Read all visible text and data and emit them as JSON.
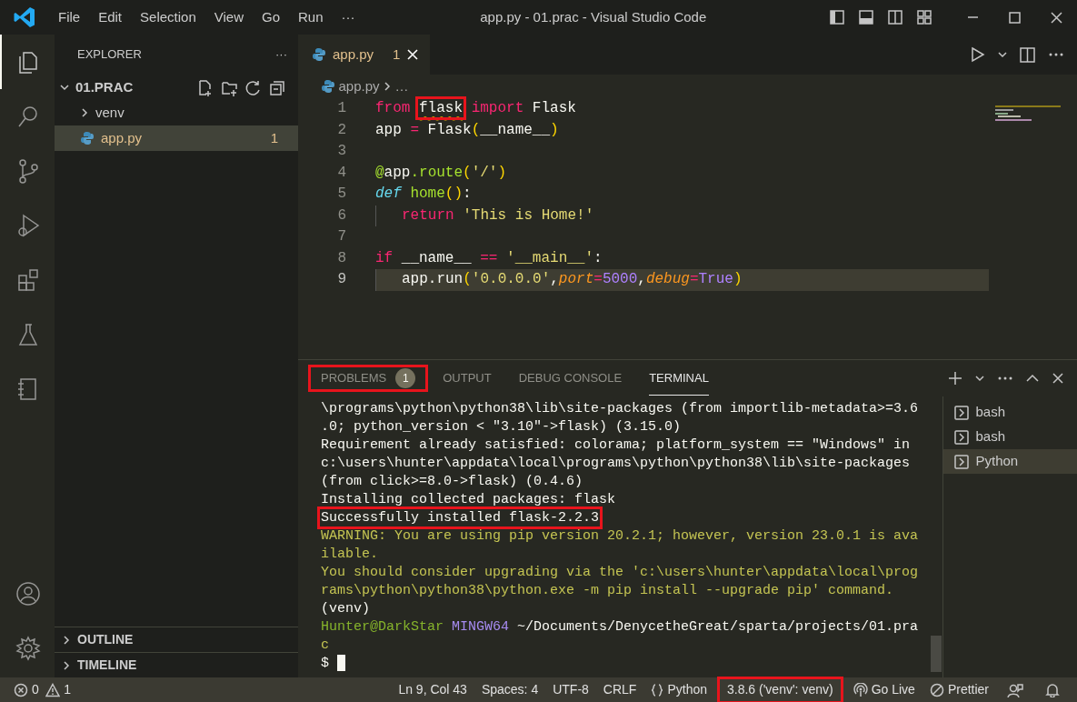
{
  "window": {
    "title": "app.py - 01.prac - Visual Studio Code"
  },
  "menu": [
    "File",
    "Edit",
    "Selection",
    "View",
    "Go",
    "Run",
    "···"
  ],
  "activity_bar": [
    {
      "kind": "explorer",
      "selected": true
    },
    {
      "kind": "search",
      "selected": false
    },
    {
      "kind": "source-control",
      "selected": false
    },
    {
      "kind": "run-debug",
      "selected": false
    },
    {
      "kind": "extensions",
      "selected": false
    },
    {
      "kind": "testing",
      "selected": false
    },
    {
      "kind": "notebook",
      "selected": false
    },
    {
      "kind": "account",
      "selected": false
    },
    {
      "kind": "settings",
      "selected": false
    }
  ],
  "sidebar": {
    "title": "EXPLORER",
    "more": "···",
    "folder": {
      "name": "01.PRAC",
      "expanded": true,
      "children": [
        {
          "name": "venv",
          "kind": "folder",
          "expanded": false,
          "selected": false
        },
        {
          "name": "app.py",
          "kind": "python",
          "problems": "1",
          "selected": true
        }
      ]
    },
    "sections": [
      {
        "name": "OUTLINE",
        "expanded": false
      },
      {
        "name": "TIMELINE",
        "expanded": false
      }
    ]
  },
  "editor": {
    "tabs": [
      {
        "label": "app.py",
        "problems": "1",
        "selected": true
      }
    ],
    "breadcrumb": [
      "app.py",
      "…"
    ],
    "lines": [
      {
        "number": "1",
        "current": false,
        "tokens": [
          {
            "text": "from ",
            "kind": "keyword"
          },
          {
            "text": "flask",
            "kind": "plain",
            "squiggle": true,
            "highlighted": true
          },
          {
            "text": " import",
            "kind": "keyword"
          },
          {
            "text": " Flask",
            "kind": "plain"
          }
        ]
      },
      {
        "number": "2",
        "current": false,
        "tokens": [
          {
            "text": "app ",
            "kind": "plain"
          },
          {
            "text": "=",
            "kind": "keyword"
          },
          {
            "text": " Flask",
            "kind": "plain"
          },
          {
            "text": "(",
            "kind": "bracket"
          },
          {
            "text": "__name__",
            "kind": "plain"
          },
          {
            "text": ")",
            "kind": "bracket"
          }
        ]
      },
      {
        "number": "3",
        "current": false
      },
      {
        "number": "4",
        "current": false,
        "tokens": [
          {
            "text": "@",
            "kind": "func"
          },
          {
            "text": "app",
            "kind": "plain"
          },
          {
            "text": ".route",
            "kind": "func"
          },
          {
            "text": "(",
            "kind": "bracket"
          },
          {
            "text": "'/'",
            "kind": "string"
          },
          {
            "text": ")",
            "kind": "bracket"
          }
        ]
      },
      {
        "number": "5",
        "current": false,
        "tokens": [
          {
            "text": "def",
            "kind": "storage"
          },
          {
            "text": " home",
            "kind": "func"
          },
          {
            "text": "()",
            "kind": "bracket"
          },
          {
            "text": ":",
            "kind": "plain"
          }
        ]
      },
      {
        "number": "6",
        "current": false,
        "indented": true,
        "tokens": [
          {
            "text": "return",
            "kind": "keyword"
          },
          {
            "text": " 'This is Home!'",
            "kind": "string"
          }
        ]
      },
      {
        "number": "7",
        "current": false
      },
      {
        "number": "8",
        "current": false,
        "tokens": [
          {
            "text": "if",
            "kind": "keyword"
          },
          {
            "text": " __name__ ",
            "kind": "plain"
          },
          {
            "text": "==",
            "kind": "keyword"
          },
          {
            "text": " '__main__'",
            "kind": "string"
          },
          {
            "text": ":",
            "kind": "plain"
          }
        ]
      },
      {
        "number": "9",
        "current": true,
        "indented": true,
        "tokens": [
          {
            "text": "app.run",
            "kind": "plain"
          },
          {
            "text": "(",
            "kind": "bracket"
          },
          {
            "text": "'0.0.0.0'",
            "kind": "string"
          },
          {
            "text": ",",
            "kind": "plain"
          },
          {
            "text": "port",
            "kind": "param"
          },
          {
            "text": "=",
            "kind": "keyword"
          },
          {
            "text": "5000",
            "kind": "number"
          },
          {
            "text": ",",
            "kind": "plain"
          },
          {
            "text": "debug",
            "kind": "param"
          },
          {
            "text": "=",
            "kind": "keyword"
          },
          {
            "text": "True",
            "kind": "number"
          },
          {
            "text": ")",
            "kind": "bracket"
          }
        ]
      }
    ]
  },
  "panel": {
    "tabs": [
      {
        "label": "PROBLEMS",
        "badge": "1",
        "selected": false,
        "highlighted": true
      },
      {
        "label": "OUTPUT",
        "selected": false,
        "highlighted": false
      },
      {
        "label": "DEBUG CONSOLE",
        "selected": false,
        "highlighted": false
      },
      {
        "label": "TERMINAL",
        "selected": true,
        "highlighted": false
      }
    ],
    "terminal_lines": [
      {
        "highlighted": false,
        "segments": [
          {
            "text": "\\programs\\python\\python38\\lib\\site-packages (from importlib-metadata>=3.6",
            "kind": "output"
          }
        ]
      },
      {
        "highlighted": false,
        "segments": [
          {
            "text": ".0; python_version < \"3.10\"->flask) (3.15.0)",
            "kind": "output"
          }
        ]
      },
      {
        "highlighted": false,
        "segments": [
          {
            "text": "Requirement already satisfied: colorama; platform_system == \"Windows\" in",
            "kind": "output"
          }
        ]
      },
      {
        "highlighted": false,
        "segments": [
          {
            "text": "c:\\users\\hunter\\appdata\\local\\programs\\python\\python38\\lib\\site-packages",
            "kind": "output"
          }
        ]
      },
      {
        "highlighted": false,
        "segments": [
          {
            "text": "(from click>=8.0->flask) (0.4.6)",
            "kind": "output"
          }
        ]
      },
      {
        "highlighted": false,
        "segments": [
          {
            "text": "Installing collected packages: flask",
            "kind": "output"
          }
        ]
      },
      {
        "highlighted": true,
        "segments": [
          {
            "text": "Successfully installed flask-2.2.3",
            "kind": "output"
          }
        ]
      },
      {
        "highlighted": false,
        "segments": [
          {
            "text": "WARNING: You are using pip version 20.2.1; however, version 23.0.1 is ava",
            "kind": "warning"
          }
        ]
      },
      {
        "highlighted": false,
        "segments": [
          {
            "text": "ilable.",
            "kind": "warning"
          }
        ]
      },
      {
        "highlighted": false,
        "segments": [
          {
            "text": "You should consider upgrading via the 'c:\\users\\hunter\\appdata\\local\\prog",
            "kind": "warning"
          }
        ]
      },
      {
        "highlighted": false,
        "segments": [
          {
            "text": "rams\\python\\python38\\python.exe -m pip install --upgrade pip' command.",
            "kind": "warning"
          }
        ]
      },
      {
        "highlighted": false,
        "segments": [
          {
            "text": "(venv)",
            "kind": "output"
          }
        ]
      },
      {
        "highlighted": false,
        "segments": [
          {
            "text": "Hunter@DarkStar",
            "kind": "user"
          },
          {
            "text": " MINGW64",
            "kind": "system"
          },
          {
            "text": " ~/Documents/DenycetheGreat/sparta/projects/01.pra",
            "kind": "output"
          }
        ]
      },
      {
        "highlighted": false,
        "segments": [
          {
            "text": "c",
            "kind": "system-dim"
          }
        ]
      },
      {
        "highlighted": false,
        "cursor": true,
        "segments": [
          {
            "text": "$ ",
            "kind": "output"
          }
        ]
      }
    ],
    "terminals": [
      {
        "label": "bash",
        "selected": false
      },
      {
        "label": "bash",
        "selected": false
      },
      {
        "label": "Python",
        "selected": true
      }
    ]
  },
  "status_bar": {
    "left": [
      {
        "kind": "errors",
        "text": "0"
      },
      {
        "kind": "warnings",
        "text": "1"
      }
    ],
    "right": [
      {
        "text": "Ln 9, Col 43",
        "kind": "position",
        "highlighted": false
      },
      {
        "text": "Spaces: 4",
        "kind": "indentation",
        "highlighted": false
      },
      {
        "text": "UTF-8",
        "kind": "encoding",
        "highlighted": false
      },
      {
        "text": "CRLF",
        "kind": "eol",
        "highlighted": false
      },
      {
        "text": "Python",
        "kind": "language",
        "highlighted": false
      },
      {
        "text": "3.8.6 ('venv': venv)",
        "kind": "interpreter",
        "highlighted": true
      },
      {
        "text": "Go Live",
        "kind": "live-server",
        "highlighted": false
      },
      {
        "text": "Prettier",
        "kind": "formatter",
        "highlighted": false
      },
      {
        "kind": "feedback",
        "highlighted": false
      },
      {
        "kind": "notifications",
        "highlighted": false
      }
    ]
  }
}
